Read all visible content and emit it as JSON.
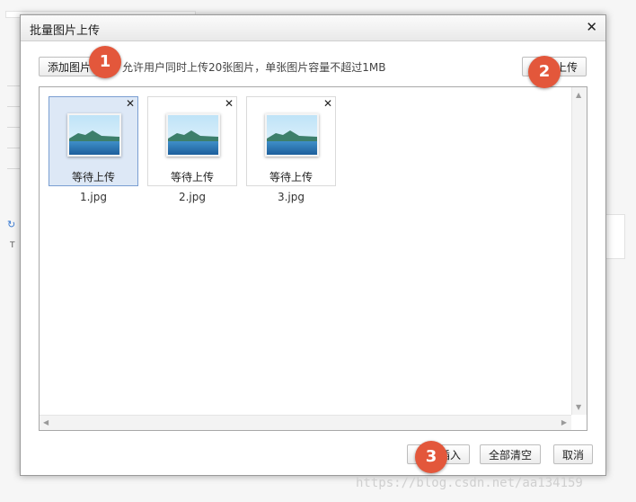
{
  "dialog": {
    "title": "批量图片上传",
    "close_icon": "close-icon",
    "toolbar": {
      "add_image_label": "添加图片",
      "hint": "允许用户同时上传20张图片，单张图片容量不超过1MB",
      "upload_label": "上传"
    },
    "files": [
      {
        "name": "1.jpg",
        "status": "等待上传",
        "selected": true
      },
      {
        "name": "2.jpg",
        "status": "等待上传",
        "selected": false
      },
      {
        "name": "3.jpg",
        "status": "等待上传",
        "selected": false
      }
    ],
    "footer": {
      "insert_label": "插入",
      "clear_all_label": "全部清空",
      "cancel_label": "取消"
    }
  },
  "badges": [
    "1",
    "2",
    "3"
  ],
  "watermark": "https://blog.csdn.net/aa134159",
  "colors": {
    "badge": "#e3573b",
    "selected_border": "#7a9ed1",
    "selected_bg": "#dde8f6"
  }
}
